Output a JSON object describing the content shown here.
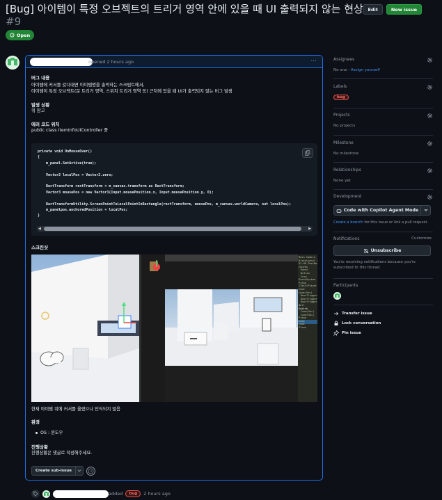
{
  "issue": {
    "title": "[Bug] 아이템이 특정 오브젝트의 트리거 영역 안에 있을 때 UI 출력되지 않는 현상",
    "number": "#9",
    "state": "Open",
    "edit_label": "Edit",
    "new_issue_label": "New issue"
  },
  "comment": {
    "meta": "opened 2 hours ago",
    "bug_heading": "버그 내용",
    "bug_desc_1": "아이템에 커서를 갖다대면 아이템명을 출력하는 스크립트에서,",
    "bug_desc_2": "아이템이 특정 오브젝트(문 트리거 영역, 스위치 트리거 영역 등) 근처에 있을 때 UI가 출력되지 않는 버그 발생",
    "occur_heading": "발생 상황",
    "occur_text": "위 참고",
    "error_heading": "에러 코드 위치",
    "error_text": "public class ItemInfoUIController 중",
    "code": "private void OnMouseOver()\n{\n    m_panel.SetActive(true);\n\n    Vector2 localPos = Vector2.zero;\n\n    RectTransform rectTransform = m_canvas.transform as RectTransform;\n    Vector3 mousePos = new Vector3(Input.mousePosition.x, Input.mousePosition.y, 0);\n\n    RectTransformUtility.ScreenPointToLocalPointInRectangle(rectTransform, mousePos, m_canvas.worldCamera, out localPos);\n    m_panelpos.anchoredPosition = localPos;\n}",
    "screenshot_heading": "스크린샷",
    "screenshot_caption": "현재 아이템 위에 커서를 올렸으나 인식되지 않음",
    "env_heading": "환경",
    "env_item": "OS : 윈도우",
    "progress_heading": "진행상황",
    "progress_text": "진행상황은 댓글로 작성해주세요.",
    "create_subissue": "Create sub-issue"
  },
  "hierarchy": [
    "Main Camera",
    "Directional Light",
    "UI-HP-TextBar",
    "Canvas",
    "Panel",
    "Button",
    "Icon",
    "EventSystem",
    "Plane",
    "(Test)Player",
    "Cube",
    "Cube(Sec)",
    "DoorTrigger",
    "DoorTrigger",
    "DoorTrigger",
    "Wall",
    "Switch",
    "Cube(Sec)",
    "Cube(Sec)",
    "Plane",
    "Cube",
    "Cube",
    "Plane"
  ],
  "timeline": {
    "added": "added",
    "label": "bug",
    "time": "2 hours ago"
  },
  "sidebar": {
    "assignees": "Assignees",
    "assignees_none": "No one -",
    "assign_yourself": "Assign yourself",
    "labels": "Labels",
    "label_bug": "bug",
    "projects": "Projects",
    "projects_none": "No projects",
    "milestone": "Milestone",
    "milestone_none": "No milestone",
    "relationships": "Relationships",
    "relationships_none": "None yet",
    "development": "Development",
    "copilot_btn": "Code with Copilot Agent Mode",
    "create_branch": "Create a branch",
    "branch_rest": " for this issue or link a pull request.",
    "notifications": "Notifications",
    "customize": "Customize",
    "unsubscribe": "Unsubscribe",
    "notif_text": "You're receiving notifications because you're subscribed to this thread.",
    "participants": "Participants",
    "transfer": "Transfer issue",
    "lock": "Lock conversation",
    "pin": "Pin issue"
  },
  "colors": {
    "bg": "#0d1117",
    "accent_blue": "#1f6feb",
    "open_green": "#238636",
    "bug_red": "#e5534b"
  }
}
